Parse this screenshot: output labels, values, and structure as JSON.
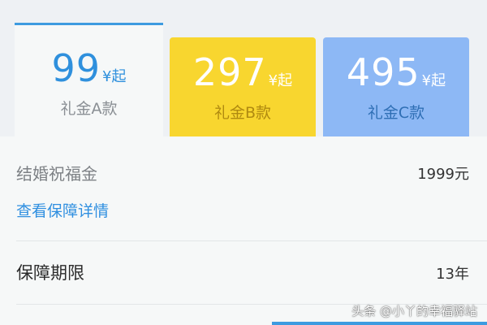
{
  "tabs": [
    {
      "price": "99",
      "unit": "¥起",
      "name": "礼金A款"
    },
    {
      "price": "297",
      "unit": "¥起",
      "name": "礼金B款"
    },
    {
      "price": "495",
      "unit": "¥起",
      "name": "礼金C款"
    }
  ],
  "details": {
    "gift_label": "结婚祝福金",
    "gift_value": "1999元",
    "coverage_link": "查看保障详情",
    "term_label": "保障期限",
    "term_value": "13年"
  },
  "watermark": "头条 @小丫的幸福驿站",
  "colors": {
    "accent": "#3d9be0",
    "tab_b": "#f8d62f",
    "tab_c": "#8db8f5"
  }
}
